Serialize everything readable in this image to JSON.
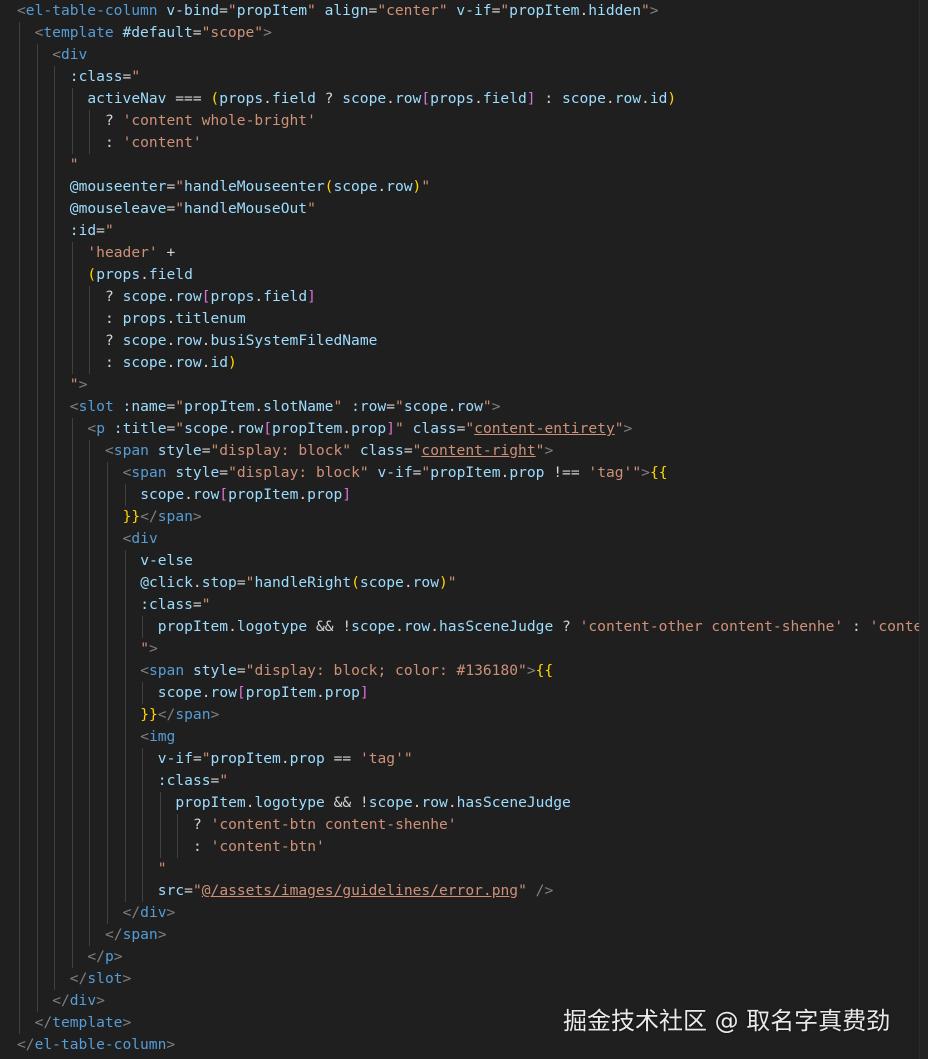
{
  "colors": {
    "background": "#1f1f1f",
    "tag": "#569cd6",
    "attribute": "#9cdcfe",
    "string": "#ce9178",
    "default": "#d4d4d4",
    "bracket_gold": "#ffd700",
    "bracket_pink": "#da70d6",
    "bracket_blue": "#179fff",
    "punct": "#808080"
  },
  "watermark": "掘金技术社区 @ 取名字真费劲",
  "code_lines": [
    {
      "indent": 0,
      "tokens": [
        [
          "p",
          "<"
        ],
        [
          "t",
          "el-table-column"
        ],
        [
          "x",
          " "
        ],
        [
          "a",
          "v-bind"
        ],
        [
          "x",
          "="
        ],
        [
          "s",
          "\""
        ],
        [
          "a",
          "propItem"
        ],
        [
          "s",
          "\""
        ],
        [
          "x",
          " "
        ],
        [
          "a",
          "align"
        ],
        [
          "x",
          "="
        ],
        [
          "s",
          "\"center\""
        ],
        [
          "x",
          " "
        ],
        [
          "a",
          "v-if"
        ],
        [
          "x",
          "="
        ],
        [
          "s",
          "\""
        ],
        [
          "a",
          "propItem"
        ],
        [
          "x",
          "."
        ],
        [
          "a",
          "hidden"
        ],
        [
          "s",
          "\""
        ],
        [
          "p",
          ">"
        ]
      ]
    },
    {
      "indent": 1,
      "tokens": [
        [
          "p",
          "<"
        ],
        [
          "t",
          "template"
        ],
        [
          "x",
          " "
        ],
        [
          "a",
          "#default"
        ],
        [
          "x",
          "="
        ],
        [
          "s",
          "\"scope\""
        ],
        [
          "p",
          ">"
        ]
      ]
    },
    {
      "indent": 2,
      "tokens": [
        [
          "p",
          "<"
        ],
        [
          "t",
          "div"
        ]
      ]
    },
    {
      "indent": 3,
      "tokens": [
        [
          "a",
          ":class"
        ],
        [
          "x",
          "="
        ],
        [
          "s",
          "\""
        ]
      ]
    },
    {
      "indent": 4,
      "tokens": [
        [
          "a",
          "activeNav"
        ],
        [
          "x",
          " === "
        ],
        [
          "g",
          "("
        ],
        [
          "a",
          "props"
        ],
        [
          "x",
          "."
        ],
        [
          "a",
          "field"
        ],
        [
          "x",
          " ? "
        ],
        [
          "a",
          "scope"
        ],
        [
          "x",
          "."
        ],
        [
          "a",
          "row"
        ],
        [
          "k",
          "["
        ],
        [
          "a",
          "props"
        ],
        [
          "x",
          "."
        ],
        [
          "a",
          "field"
        ],
        [
          "k",
          "]"
        ],
        [
          "x",
          " : "
        ],
        [
          "a",
          "scope"
        ],
        [
          "x",
          "."
        ],
        [
          "a",
          "row"
        ],
        [
          "x",
          "."
        ],
        [
          "a",
          "id"
        ],
        [
          "g",
          ")"
        ]
      ]
    },
    {
      "indent": 5,
      "tokens": [
        [
          "x",
          "? "
        ],
        [
          "s",
          "'content whole-bright'"
        ]
      ]
    },
    {
      "indent": 5,
      "tokens": [
        [
          "x",
          ": "
        ],
        [
          "s",
          "'content'"
        ]
      ]
    },
    {
      "indent": 3,
      "tokens": [
        [
          "s",
          "\""
        ]
      ]
    },
    {
      "indent": 3,
      "tokens": [
        [
          "a",
          "@mouseenter"
        ],
        [
          "x",
          "="
        ],
        [
          "s",
          "\""
        ],
        [
          "a",
          "handleMouseenter"
        ],
        [
          "g",
          "("
        ],
        [
          "a",
          "scope"
        ],
        [
          "x",
          "."
        ],
        [
          "a",
          "row"
        ],
        [
          "g",
          ")"
        ],
        [
          "s",
          "\""
        ]
      ]
    },
    {
      "indent": 3,
      "tokens": [
        [
          "a",
          "@mouseleave"
        ],
        [
          "x",
          "="
        ],
        [
          "s",
          "\""
        ],
        [
          "a",
          "handleMouseOut"
        ],
        [
          "s",
          "\""
        ]
      ]
    },
    {
      "indent": 3,
      "tokens": [
        [
          "a",
          ":id"
        ],
        [
          "x",
          "="
        ],
        [
          "s",
          "\""
        ]
      ]
    },
    {
      "indent": 4,
      "tokens": [
        [
          "s",
          "'header'"
        ],
        [
          "x",
          " +"
        ]
      ]
    },
    {
      "indent": 4,
      "tokens": [
        [
          "g",
          "("
        ],
        [
          "a",
          "props"
        ],
        [
          "x",
          "."
        ],
        [
          "a",
          "field"
        ]
      ]
    },
    {
      "indent": 5,
      "tokens": [
        [
          "x",
          "? "
        ],
        [
          "a",
          "scope"
        ],
        [
          "x",
          "."
        ],
        [
          "a",
          "row"
        ],
        [
          "k",
          "["
        ],
        [
          "a",
          "props"
        ],
        [
          "x",
          "."
        ],
        [
          "a",
          "field"
        ],
        [
          "k",
          "]"
        ]
      ]
    },
    {
      "indent": 5,
      "tokens": [
        [
          "x",
          ": "
        ],
        [
          "a",
          "props"
        ],
        [
          "x",
          "."
        ],
        [
          "a",
          "titlenum"
        ]
      ]
    },
    {
      "indent": 5,
      "tokens": [
        [
          "x",
          "? "
        ],
        [
          "a",
          "scope"
        ],
        [
          "x",
          "."
        ],
        [
          "a",
          "row"
        ],
        [
          "x",
          "."
        ],
        [
          "a",
          "busiSystemFiledName"
        ]
      ]
    },
    {
      "indent": 5,
      "tokens": [
        [
          "x",
          ": "
        ],
        [
          "a",
          "scope"
        ],
        [
          "x",
          "."
        ],
        [
          "a",
          "row"
        ],
        [
          "x",
          "."
        ],
        [
          "a",
          "id"
        ],
        [
          "g",
          ")"
        ]
      ]
    },
    {
      "indent": 3,
      "tokens": [
        [
          "s",
          "\""
        ],
        [
          "p",
          ">"
        ]
      ]
    },
    {
      "indent": 3,
      "tokens": [
        [
          "p",
          "<"
        ],
        [
          "t",
          "slot"
        ],
        [
          "x",
          " "
        ],
        [
          "a",
          ":name"
        ],
        [
          "x",
          "="
        ],
        [
          "s",
          "\""
        ],
        [
          "a",
          "propItem"
        ],
        [
          "x",
          "."
        ],
        [
          "a",
          "slotName"
        ],
        [
          "s",
          "\""
        ],
        [
          "x",
          " "
        ],
        [
          "a",
          ":row"
        ],
        [
          "x",
          "="
        ],
        [
          "s",
          "\""
        ],
        [
          "a",
          "scope"
        ],
        [
          "x",
          "."
        ],
        [
          "a",
          "row"
        ],
        [
          "s",
          "\""
        ],
        [
          "p",
          ">"
        ]
      ]
    },
    {
      "indent": 4,
      "tokens": [
        [
          "p",
          "<"
        ],
        [
          "t",
          "p"
        ],
        [
          "x",
          " "
        ],
        [
          "a",
          ":title"
        ],
        [
          "x",
          "="
        ],
        [
          "s",
          "\""
        ],
        [
          "a",
          "scope"
        ],
        [
          "x",
          "."
        ],
        [
          "a",
          "row"
        ],
        [
          "k",
          "["
        ],
        [
          "a",
          "propItem"
        ],
        [
          "x",
          "."
        ],
        [
          "a",
          "prop"
        ],
        [
          "k",
          "]"
        ],
        [
          "s",
          "\""
        ],
        [
          "x",
          " "
        ],
        [
          "a",
          "class"
        ],
        [
          "x",
          "="
        ],
        [
          "s",
          "\""
        ],
        [
          "u",
          "content-entirety"
        ],
        [
          "s",
          "\""
        ],
        [
          "p",
          ">"
        ]
      ]
    },
    {
      "indent": 5,
      "tokens": [
        [
          "p",
          "<"
        ],
        [
          "t",
          "span"
        ],
        [
          "x",
          " "
        ],
        [
          "a",
          "style"
        ],
        [
          "x",
          "="
        ],
        [
          "s",
          "\"display: block\""
        ],
        [
          "x",
          " "
        ],
        [
          "a",
          "class"
        ],
        [
          "x",
          "="
        ],
        [
          "s",
          "\""
        ],
        [
          "u",
          "content-right"
        ],
        [
          "s",
          "\""
        ],
        [
          "p",
          ">"
        ]
      ]
    },
    {
      "indent": 6,
      "tokens": [
        [
          "p",
          "<"
        ],
        [
          "t",
          "span"
        ],
        [
          "x",
          " "
        ],
        [
          "a",
          "style"
        ],
        [
          "x",
          "="
        ],
        [
          "s",
          "\"display: block\""
        ],
        [
          "x",
          " "
        ],
        [
          "a",
          "v-if"
        ],
        [
          "x",
          "="
        ],
        [
          "s",
          "\""
        ],
        [
          "a",
          "propItem"
        ],
        [
          "x",
          "."
        ],
        [
          "a",
          "prop"
        ],
        [
          "x",
          " !== "
        ],
        [
          "s",
          "'tag'"
        ],
        [
          "s",
          "\""
        ],
        [
          "p",
          ">"
        ],
        [
          "y",
          "{{"
        ]
      ]
    },
    {
      "indent": 7,
      "tokens": [
        [
          "a",
          "scope"
        ],
        [
          "x",
          "."
        ],
        [
          "a",
          "row"
        ],
        [
          "k",
          "["
        ],
        [
          "a",
          "propItem"
        ],
        [
          "x",
          "."
        ],
        [
          "a",
          "prop"
        ],
        [
          "k",
          "]"
        ]
      ]
    },
    {
      "indent": 6,
      "tokens": [
        [
          "y",
          "}}"
        ],
        [
          "p",
          "</"
        ],
        [
          "t",
          "span"
        ],
        [
          "p",
          ">"
        ]
      ]
    },
    {
      "indent": 6,
      "tokens": [
        [
          "p",
          "<"
        ],
        [
          "t",
          "div"
        ]
      ]
    },
    {
      "indent": 7,
      "tokens": [
        [
          "a",
          "v-else"
        ]
      ]
    },
    {
      "indent": 7,
      "tokens": [
        [
          "a",
          "@click"
        ],
        [
          "x",
          "."
        ],
        [
          "a",
          "stop"
        ],
        [
          "x",
          "="
        ],
        [
          "s",
          "\""
        ],
        [
          "a",
          "handleRight"
        ],
        [
          "g",
          "("
        ],
        [
          "a",
          "scope"
        ],
        [
          "x",
          "."
        ],
        [
          "a",
          "row"
        ],
        [
          "g",
          ")"
        ],
        [
          "s",
          "\""
        ]
      ]
    },
    {
      "indent": 7,
      "tokens": [
        [
          "a",
          ":class"
        ],
        [
          "x",
          "="
        ],
        [
          "s",
          "\""
        ]
      ]
    },
    {
      "indent": 8,
      "tokens": [
        [
          "a",
          "propItem"
        ],
        [
          "x",
          "."
        ],
        [
          "a",
          "logotype"
        ],
        [
          "x",
          " && !"
        ],
        [
          "a",
          "scope"
        ],
        [
          "x",
          "."
        ],
        [
          "a",
          "row"
        ],
        [
          "x",
          "."
        ],
        [
          "a",
          "hasSceneJudge"
        ],
        [
          "x",
          " ? "
        ],
        [
          "s",
          "'content-other content-shenhe'"
        ],
        [
          "x",
          " : "
        ],
        [
          "s",
          "'content-other'"
        ]
      ]
    },
    {
      "indent": 7,
      "tokens": [
        [
          "s",
          "\""
        ],
        [
          "p",
          ">"
        ]
      ]
    },
    {
      "indent": 7,
      "tokens": [
        [
          "p",
          "<"
        ],
        [
          "t",
          "span"
        ],
        [
          "x",
          " "
        ],
        [
          "a",
          "style"
        ],
        [
          "x",
          "="
        ],
        [
          "s",
          "\"display: block; color: #136180\""
        ],
        [
          "p",
          ">"
        ],
        [
          "y",
          "{{"
        ]
      ]
    },
    {
      "indent": 8,
      "tokens": [
        [
          "a",
          "scope"
        ],
        [
          "x",
          "."
        ],
        [
          "a",
          "row"
        ],
        [
          "k",
          "["
        ],
        [
          "a",
          "propItem"
        ],
        [
          "x",
          "."
        ],
        [
          "a",
          "prop"
        ],
        [
          "k",
          "]"
        ]
      ]
    },
    {
      "indent": 7,
      "tokens": [
        [
          "y",
          "}}"
        ],
        [
          "p",
          "</"
        ],
        [
          "t",
          "span"
        ],
        [
          "p",
          ">"
        ]
      ]
    },
    {
      "indent": 7,
      "tokens": [
        [
          "p",
          "<"
        ],
        [
          "t",
          "img"
        ]
      ]
    },
    {
      "indent": 8,
      "tokens": [
        [
          "a",
          "v-if"
        ],
        [
          "x",
          "="
        ],
        [
          "s",
          "\""
        ],
        [
          "a",
          "propItem"
        ],
        [
          "x",
          "."
        ],
        [
          "a",
          "prop"
        ],
        [
          "x",
          " == "
        ],
        [
          "s",
          "'tag'"
        ],
        [
          "s",
          "\""
        ]
      ]
    },
    {
      "indent": 8,
      "tokens": [
        [
          "a",
          ":class"
        ],
        [
          "x",
          "="
        ],
        [
          "s",
          "\""
        ]
      ]
    },
    {
      "indent": 9,
      "tokens": [
        [
          "a",
          "propItem"
        ],
        [
          "x",
          "."
        ],
        [
          "a",
          "logotype"
        ],
        [
          "x",
          " && !"
        ],
        [
          "a",
          "scope"
        ],
        [
          "x",
          "."
        ],
        [
          "a",
          "row"
        ],
        [
          "x",
          "."
        ],
        [
          "a",
          "hasSceneJudge"
        ]
      ]
    },
    {
      "indent": 10,
      "tokens": [
        [
          "x",
          "? "
        ],
        [
          "s",
          "'content-btn content-shenhe'"
        ]
      ]
    },
    {
      "indent": 10,
      "tokens": [
        [
          "x",
          ": "
        ],
        [
          "s",
          "'content-btn'"
        ]
      ]
    },
    {
      "indent": 8,
      "tokens": [
        [
          "s",
          "\""
        ]
      ]
    },
    {
      "indent": 8,
      "tokens": [
        [
          "a",
          "src"
        ],
        [
          "x",
          "="
        ],
        [
          "s",
          "\""
        ],
        [
          "u",
          "@/assets/images/guidelines/error.png"
        ],
        [
          "s",
          "\""
        ],
        [
          "x",
          " "
        ],
        [
          "p",
          "/>"
        ]
      ]
    },
    {
      "indent": 6,
      "tokens": [
        [
          "p",
          "</"
        ],
        [
          "t",
          "div"
        ],
        [
          "p",
          ">"
        ]
      ]
    },
    {
      "indent": 5,
      "tokens": [
        [
          "p",
          "</"
        ],
        [
          "t",
          "span"
        ],
        [
          "p",
          ">"
        ]
      ]
    },
    {
      "indent": 4,
      "tokens": [
        [
          "p",
          "</"
        ],
        [
          "t",
          "p"
        ],
        [
          "p",
          ">"
        ]
      ]
    },
    {
      "indent": 3,
      "tokens": [
        [
          "p",
          "</"
        ],
        [
          "t",
          "slot"
        ],
        [
          "p",
          ">"
        ]
      ]
    },
    {
      "indent": 2,
      "tokens": [
        [
          "p",
          "</"
        ],
        [
          "t",
          "div"
        ],
        [
          "p",
          ">"
        ]
      ]
    },
    {
      "indent": 1,
      "tokens": [
        [
          "p",
          "</"
        ],
        [
          "t",
          "template"
        ],
        [
          "p",
          ">"
        ]
      ]
    },
    {
      "indent": 0,
      "tokens": [
        [
          "p",
          "</"
        ],
        [
          "t",
          "el-table-column"
        ],
        [
          "p",
          ">"
        ]
      ]
    }
  ]
}
